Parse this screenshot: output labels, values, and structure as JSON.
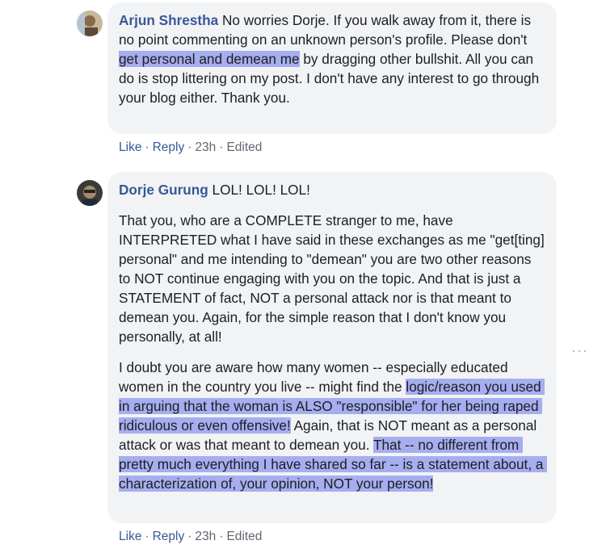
{
  "comments": [
    {
      "author": "Arjun Shrestha",
      "text_before_hl": " No worries Dorje. If you walk away from it, there is no point commenting on an unknown person's profile. Please don't ",
      "highlight": "get personal and demean me",
      "text_after_hl": " by dragging other bullshit. All you can do is stop littering on my post. I don't have any interest to go through your blog either. Thank you.",
      "actions": {
        "like": "Like",
        "reply": "Reply",
        "time": "23h",
        "edited": "Edited",
        "dot": "·"
      }
    },
    {
      "author": "Dorje Gurung",
      "first_line": " LOL! LOL! LOL!",
      "para2": "That you, who are a COMPLETE stranger to me, have INTERPRETED what I have said in these exchanges as me \"get[ting] personal\" and me intending to \"demean\" you are two other reasons to NOT continue engaging with you on the topic. And that is just a STATEMENT of fact, NOT a personal attack nor is that meant to demean you. Again, for the simple reason that I don't know you personally, at all!",
      "para3_a": "I doubt you are aware how many women -- especially educated women in the country you live -- might find the ",
      "para3_hl1": "logic/reason you used in arguing that the woman is ALSO \"responsible\" for her being raped ridiculous or even offensive!",
      "para3_b": " Again, that is NOT meant as a personal attack or was that meant to demean you. ",
      "para3_hl2": "That -- no different from pretty much everything I have shared so far -- is a statement about, a characterization of, your opinion, NOT your person!",
      "actions": {
        "like": "Like",
        "reply": "Reply",
        "time": "23h",
        "edited": "Edited",
        "dot": "·"
      }
    }
  ],
  "more_options_icon": "ellipsis-icon",
  "colors": {
    "highlight": "#a6aef0",
    "author": "#385898",
    "bubble": "#f2f3f5"
  }
}
